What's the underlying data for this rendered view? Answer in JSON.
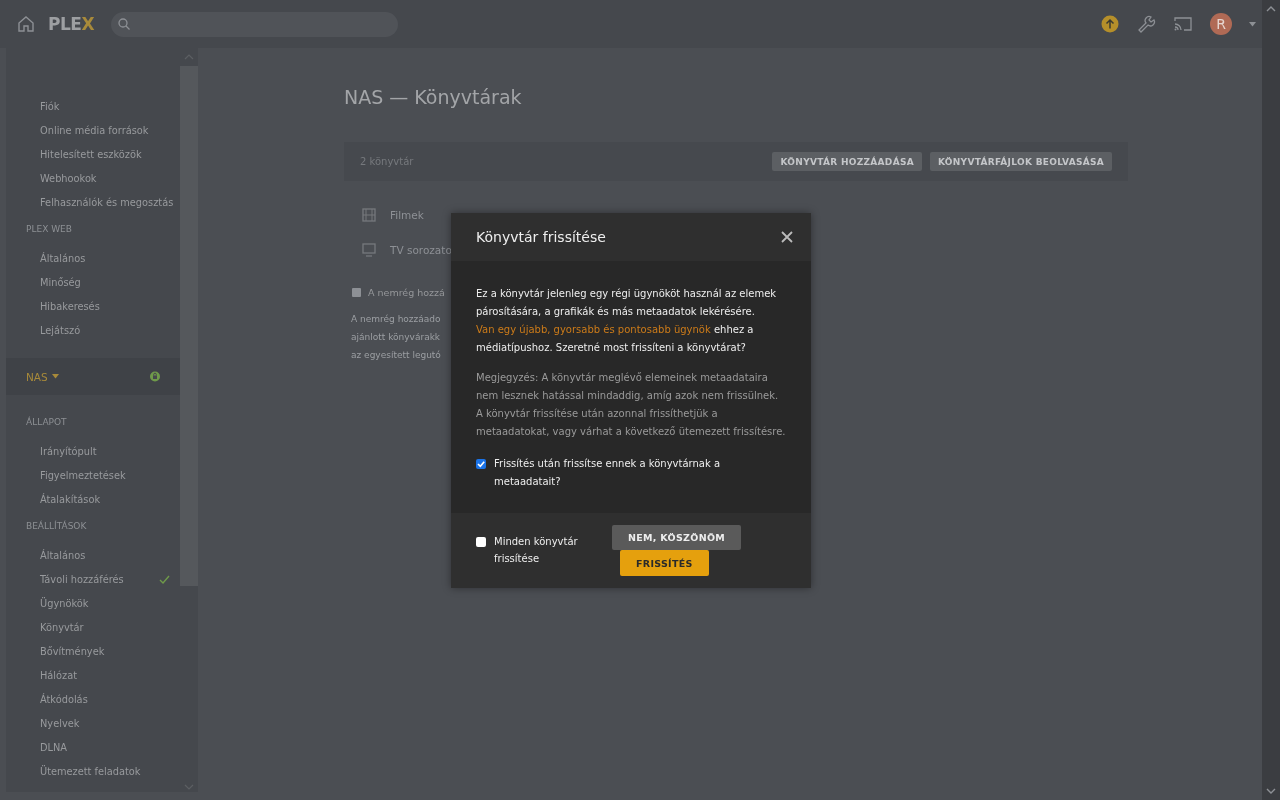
{
  "topbar": {
    "logo": "PLEX",
    "avatar": "R"
  },
  "sidebar": {
    "sections": [
      {
        "items": [
          {
            "label": "Fiók",
            "checked": false
          },
          {
            "label": "Online média források",
            "checked": false
          },
          {
            "label": "Hitelesített eszközök",
            "checked": false
          },
          {
            "label": "Webhookok",
            "checked": false
          },
          {
            "label": "Felhasználók és megosztás",
            "checked": false
          }
        ]
      },
      {
        "heading": "PLEX WEB",
        "items": [
          {
            "label": "Általános",
            "checked": false
          },
          {
            "label": "Minőség",
            "checked": false
          },
          {
            "label": "Hibakeresés",
            "checked": false
          },
          {
            "label": "Lejátszó",
            "checked": false
          }
        ]
      },
      {
        "server": "NAS"
      },
      {
        "heading": "ÁLLAPOT",
        "items": [
          {
            "label": "Irányítópult",
            "checked": false
          },
          {
            "label": "Figyelmeztetések",
            "checked": false
          },
          {
            "label": "Átalakítások",
            "checked": false
          }
        ]
      },
      {
        "heading": "BEÁLLÍTÁSOK",
        "items": [
          {
            "label": "Általános",
            "checked": false
          },
          {
            "label": "Távoli hozzáférés",
            "checked": true
          },
          {
            "label": "Ügynökök",
            "checked": false
          },
          {
            "label": "Könyvtár",
            "checked": false
          },
          {
            "label": "Bővítmények",
            "checked": false
          },
          {
            "label": "Hálózat",
            "checked": false
          },
          {
            "label": "Átkódolás",
            "checked": false
          },
          {
            "label": "Nyelvek",
            "checked": false
          },
          {
            "label": "DLNA",
            "checked": false
          },
          {
            "label": "Ütemezett feladatok",
            "checked": false
          }
        ]
      }
    ]
  },
  "main": {
    "title": "NAS — Könyvtárak",
    "count": "2 könyvtár",
    "buttons": [
      "KÖNYVTÁR HOZZÁADÁSA",
      "KÖNYVTÁRFÁJLOK BEOLVASÁSA"
    ],
    "libraries": [
      {
        "kind": "movie",
        "name": "Filmek"
      },
      {
        "kind": "tv",
        "name": "TV sorozato"
      }
    ],
    "option": {
      "label": "A nemrég hozzá",
      "checked": false
    },
    "description": [
      "A nemrég hozzáado",
      "ajánlott könyvárakk",
      "az egyesített legutó"
    ]
  },
  "dialog": {
    "title": "Könyvtár frissítése",
    "message": "Ez a könyvtár jelenleg egy régi ügynököt használ az elemek párosítására, a grafikák és más metaadatok lekérésére. ",
    "link": "Van egy újabb, gyorsabb és pontosabb ügynök",
    "message_end": " ehhez a médiatípushoz. Szeretné most frissíteni a könyvtárat?",
    "note": "Megjegyzés: A könyvtár meglévő elemeinek metaadataira nem lesznek hatással mindaddig, amíg azok nem frissülnek. A könyvtár frissítése után azonnal frissíthetjük a metaadatokat, vagy várhat a következő ütemezett frissítésre.",
    "refresh_option": {
      "label": "Frissítés után frissítse ennek a könyvtárnak a metaadatait?",
      "checked": true
    },
    "all_option": {
      "label": "Minden könyvtár frissítése",
      "checked": false
    },
    "buttons": [
      {
        "kind": "secondary",
        "label": "NEM, KÖSZÖNÖM"
      },
      {
        "kind": "primary",
        "label": "FRISSÍTÉS"
      }
    ]
  }
}
